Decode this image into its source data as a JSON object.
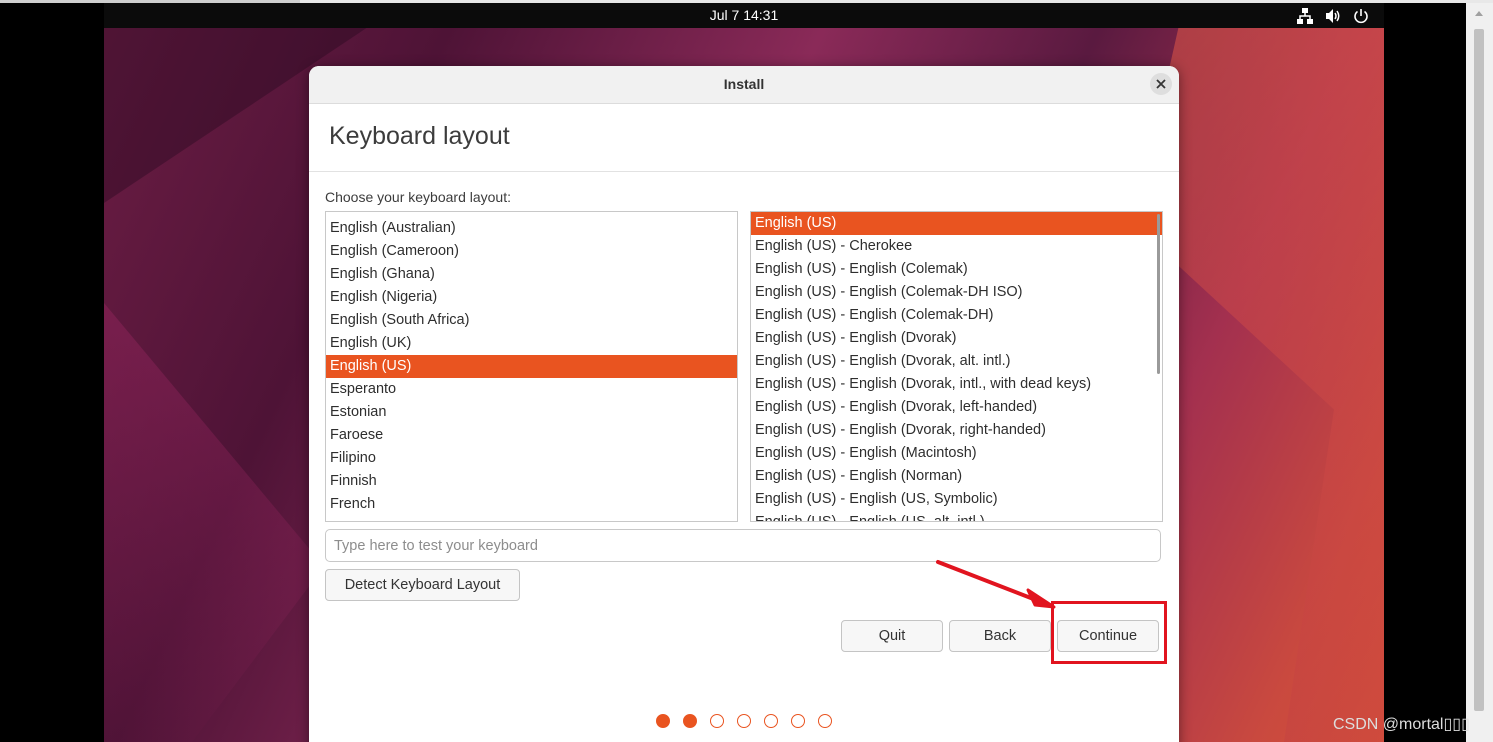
{
  "topbar": {
    "clock": "Jul 7  14:31",
    "tray_icons": [
      "network-icon",
      "volume-icon",
      "power-icon"
    ]
  },
  "window": {
    "title": "Install",
    "heading": "Keyboard layout",
    "prompt": "Choose your keyboard layout:"
  },
  "layouts": {
    "items": [
      "English (Australian)",
      "English (Cameroon)",
      "English (Ghana)",
      "English (Nigeria)",
      "English (South Africa)",
      "English (UK)",
      "English (US)",
      "Esperanto",
      "Estonian",
      "Faroese",
      "Filipino",
      "Finnish",
      "French"
    ],
    "selected_index": 6
  },
  "variants": {
    "items": [
      "English (US)",
      "English (US) - Cherokee",
      "English (US) - English (Colemak)",
      "English (US) - English (Colemak-DH ISO)",
      "English (US) - English (Colemak-DH)",
      "English (US) - English (Dvorak)",
      "English (US) - English (Dvorak, alt. intl.)",
      "English (US) - English (Dvorak, intl., with dead keys)",
      "English (US) - English (Dvorak, left-handed)",
      "English (US) - English (Dvorak, right-handed)",
      "English (US) - English (Macintosh)",
      "English (US) - English (Norman)",
      "English (US) - English (US, Symbolic)",
      "English (US) - English (US, alt. intl.)"
    ],
    "selected_index": 0
  },
  "test_input": {
    "placeholder": "Type here to test your keyboard",
    "value": ""
  },
  "buttons": {
    "detect": "Detect Keyboard Layout",
    "quit": "Quit",
    "back": "Back",
    "continue": "Continue"
  },
  "progress": {
    "total_steps": 7,
    "completed_steps": 2
  },
  "watermark": "CSDN @mortal▯▯▯",
  "colors": {
    "accent": "#e95420",
    "annotation": "#e1141f"
  }
}
